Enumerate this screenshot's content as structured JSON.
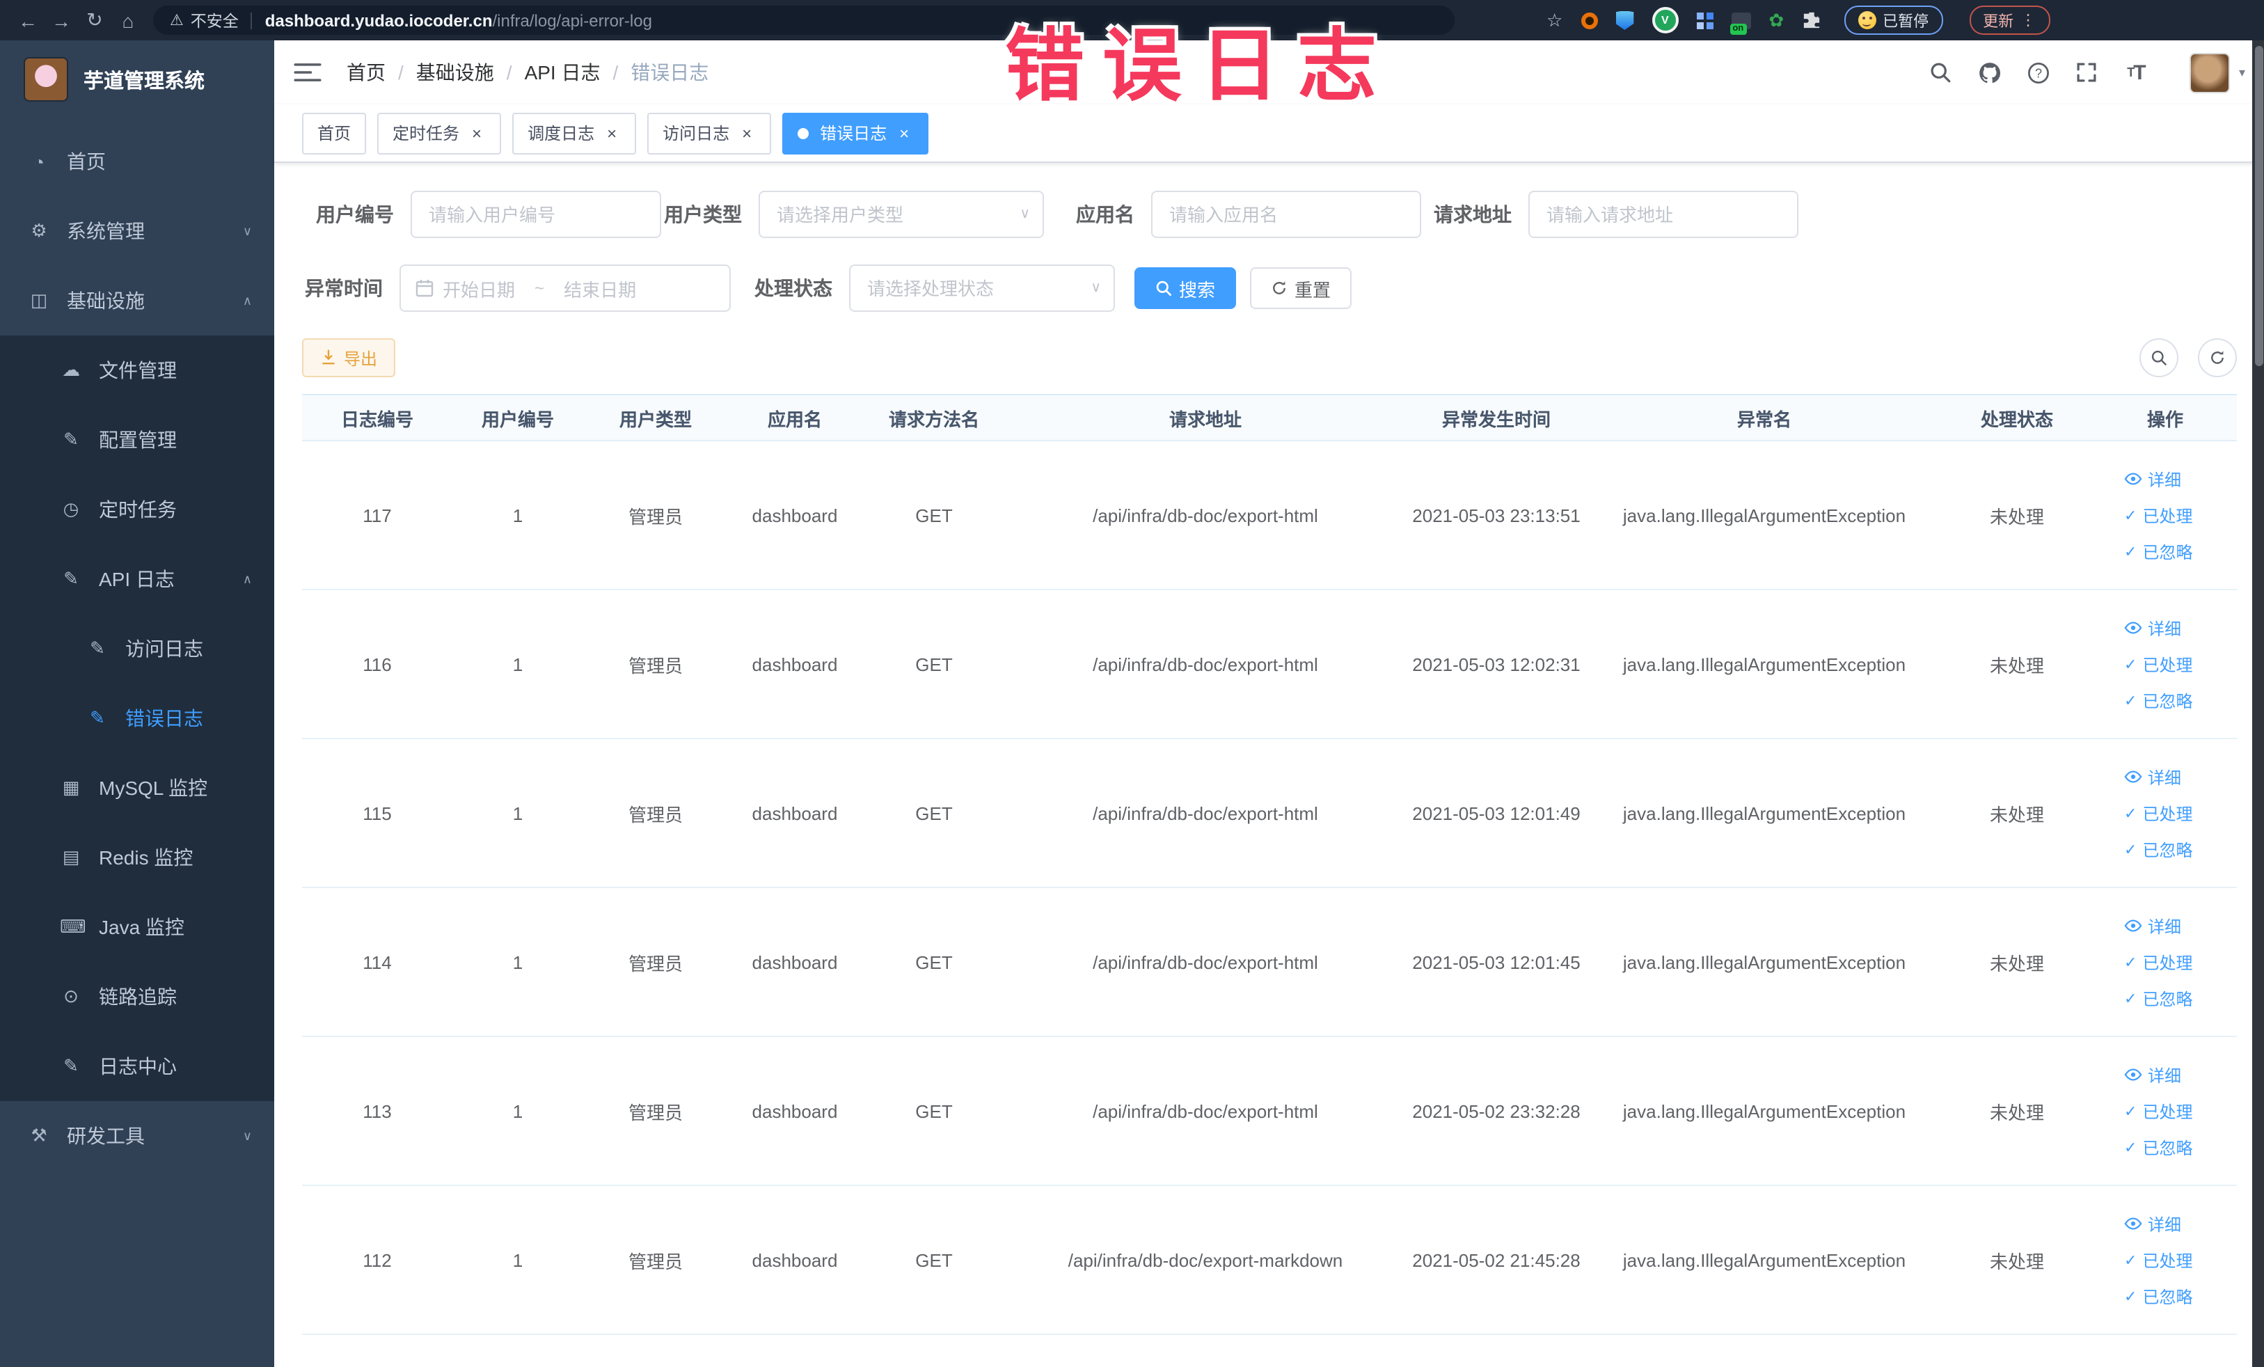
{
  "browser": {
    "security_label": "不安全",
    "url_host": "dashboard.yudao.iocoder.cn",
    "url_path": "/infra/log/api-error-log",
    "on_badge_label": "on",
    "paused_label": "已暂停",
    "update_label": "更新"
  },
  "annotation": {
    "text": "错误日志",
    "color": "#f5395c"
  },
  "sidebar": {
    "title": "芋道管理系统",
    "items": [
      {
        "icon": "dashboard-icon",
        "glyph": "◔",
        "label": "首页"
      },
      {
        "icon": "gear-icon",
        "glyph": "⚙",
        "label": "系统管理"
      },
      {
        "icon": "monitor-icon",
        "glyph": "◫",
        "label": "基础设施"
      },
      {
        "icon": "upload-cloud-icon",
        "glyph": "☁",
        "label": "文件管理"
      },
      {
        "icon": "edit-icon",
        "glyph": "✎",
        "label": "配置管理"
      },
      {
        "icon": "history-icon",
        "glyph": "◷",
        "label": "定时任务"
      },
      {
        "icon": "log-icon",
        "glyph": "✎",
        "label": "API 日志"
      },
      {
        "icon": "log-icon",
        "glyph": "✎",
        "label": "访问日志"
      },
      {
        "icon": "log-icon",
        "glyph": "✎",
        "label": "错误日志"
      },
      {
        "icon": "table-icon",
        "glyph": "▦",
        "label": "MySQL 监控"
      },
      {
        "icon": "layers-icon",
        "glyph": "▤",
        "label": "Redis 监控"
      },
      {
        "icon": "java-monitor-icon",
        "glyph": "⌨",
        "label": "Java 监控"
      },
      {
        "icon": "trace-eye-icon",
        "glyph": "⊙",
        "label": "链路追踪"
      },
      {
        "icon": "log-center-icon",
        "glyph": "✎",
        "label": "日志中心"
      },
      {
        "icon": "tools-icon",
        "glyph": "⚒",
        "label": "研发工具"
      }
    ]
  },
  "header": {
    "breadcrumb": [
      "首页",
      "基础设施",
      "API 日志",
      "错误日志"
    ]
  },
  "tags": [
    {
      "label": "首页"
    },
    {
      "label": "定时任务"
    },
    {
      "label": "调度日志"
    },
    {
      "label": "访问日志"
    },
    {
      "label": "错误日志"
    }
  ],
  "filters": {
    "user_id": {
      "label": "用户编号",
      "placeholder": "请输入用户编号"
    },
    "user_type": {
      "label": "用户类型",
      "placeholder": "请选择用户类型"
    },
    "app_name": {
      "label": "应用名",
      "placeholder": "请输入应用名"
    },
    "request_url": {
      "label": "请求地址",
      "placeholder": "请输入请求地址"
    },
    "exception_time": {
      "label": "异常时间",
      "start_placeholder": "开始日期",
      "separator": "~",
      "end_placeholder": "结束日期"
    },
    "process_status": {
      "label": "处理状态",
      "placeholder": "请选择处理状态"
    },
    "search_label": "搜索",
    "reset_label": "重置"
  },
  "toolbar": {
    "export_label": "导出"
  },
  "table": {
    "headers": [
      "日志编号",
      "用户编号",
      "用户类型",
      "应用名",
      "请求方法名",
      "请求地址",
      "异常发生时间",
      "异常名",
      "处理状态",
      "操作"
    ],
    "actions": [
      "详细",
      "已处理",
      "已忽略"
    ],
    "rows": [
      {
        "id": "117",
        "uid": "1",
        "utype": "管理员",
        "app": "dashboard",
        "method": "GET",
        "url": "/api/infra/db-doc/export-html",
        "time": "2021-05-03 23:13:51",
        "exc": "java.lang.IllegalArgumentException",
        "status": "未处理"
      },
      {
        "id": "116",
        "uid": "1",
        "utype": "管理员",
        "app": "dashboard",
        "method": "GET",
        "url": "/api/infra/db-doc/export-html",
        "time": "2021-05-03 12:02:31",
        "exc": "java.lang.IllegalArgumentException",
        "status": "未处理"
      },
      {
        "id": "115",
        "uid": "1",
        "utype": "管理员",
        "app": "dashboard",
        "method": "GET",
        "url": "/api/infra/db-doc/export-html",
        "time": "2021-05-03 12:01:49",
        "exc": "java.lang.IllegalArgumentException",
        "status": "未处理"
      },
      {
        "id": "114",
        "uid": "1",
        "utype": "管理员",
        "app": "dashboard",
        "method": "GET",
        "url": "/api/infra/db-doc/export-html",
        "time": "2021-05-03 12:01:45",
        "exc": "java.lang.IllegalArgumentException",
        "status": "未处理"
      },
      {
        "id": "113",
        "uid": "1",
        "utype": "管理员",
        "app": "dashboard",
        "method": "GET",
        "url": "/api/infra/db-doc/export-html",
        "time": "2021-05-02 23:32:28",
        "exc": "java.lang.IllegalArgumentException",
        "status": "未处理"
      },
      {
        "id": "112",
        "uid": "1",
        "utype": "管理员",
        "app": "dashboard",
        "method": "GET",
        "url": "/api/infra/db-doc/export-markdown",
        "time": "2021-05-02 21:45:28",
        "exc": "java.lang.IllegalArgumentException",
        "status": "未处理"
      }
    ]
  }
}
